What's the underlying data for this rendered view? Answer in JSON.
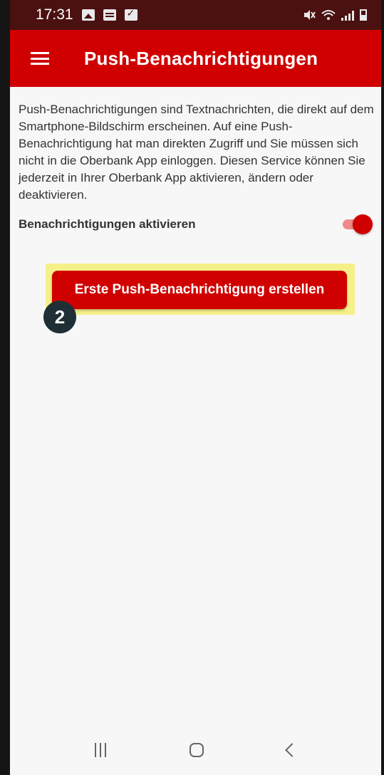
{
  "status_bar": {
    "time": "17:31",
    "left_icons": [
      "image-icon",
      "calendar-icon",
      "check-icon"
    ],
    "right_icons": [
      "mute-icon",
      "wifi-icon",
      "signal-icon",
      "battery-icon"
    ]
  },
  "app_bar": {
    "menu_icon": "hamburger-menu-icon",
    "title": "Push-Benachrichtigungen",
    "background_color": "#d00000"
  },
  "content": {
    "intro_text": "Push-Benachrichtigungen sind Textnachrichten, die direkt auf dem Smartphone-Bildschirm erscheinen. Auf eine Push-Benachrichtigung hat man direkten Zugriff und Sie müssen sich nicht in die Oberbank App einloggen. Diesen Service können Sie jederzeit in Ihrer Oberbank App aktivieren, ändern oder deaktivieren.",
    "toggle_label": "Benachrichtigungen aktivieren",
    "toggle_state": true,
    "cta_button_label": "Erste Push-Benachrichtigung erstellen",
    "step_badge": "2",
    "highlight_color": "#f6f08a"
  },
  "nav_bar": {
    "buttons": [
      "recent-apps-icon",
      "home-icon",
      "back-icon"
    ]
  }
}
